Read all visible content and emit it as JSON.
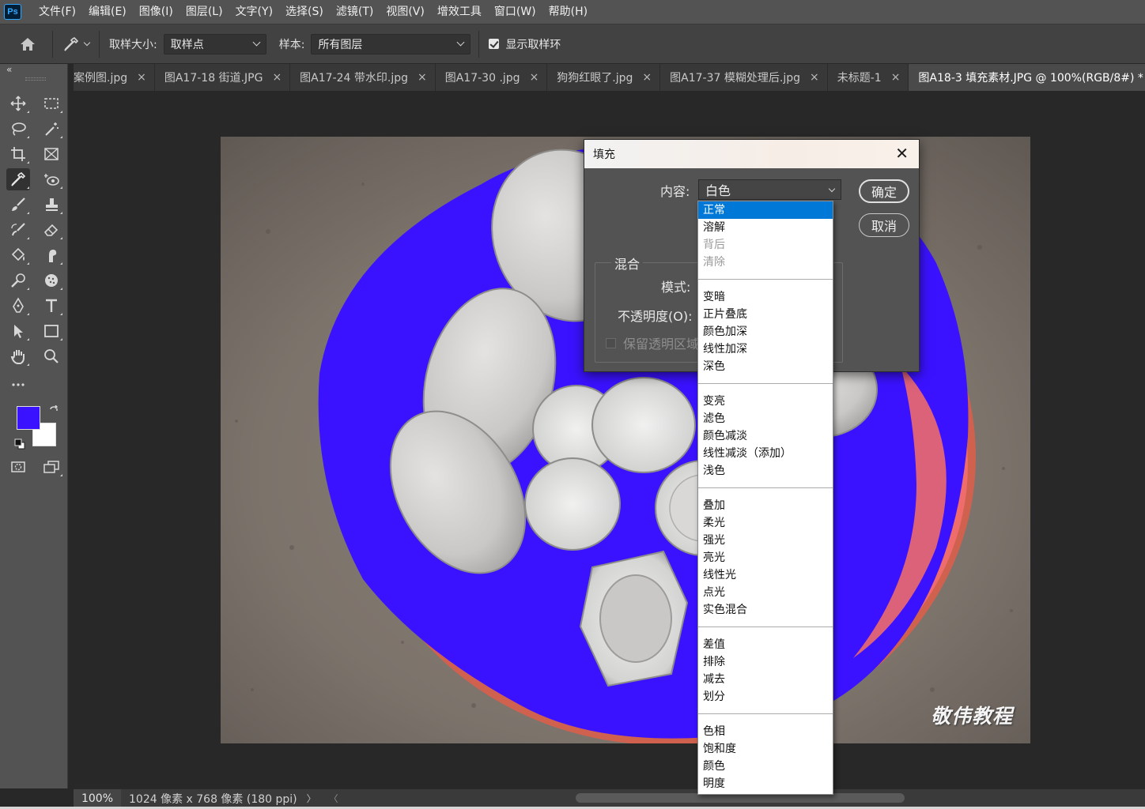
{
  "app": {
    "logo": "Ps"
  },
  "menu": [
    "文件(F)",
    "编辑(E)",
    "图像(I)",
    "图层(L)",
    "文字(Y)",
    "选择(S)",
    "滤镜(T)",
    "视图(V)",
    "增效工具",
    "窗口(W)",
    "帮助(H)"
  ],
  "options": {
    "sample_size_label": "取样大小:",
    "sample_size_value": "取样点",
    "sample_label": "样本:",
    "sample_value": "所有图层",
    "show_ring_label": "显示取样环",
    "show_ring_checked": true
  },
  "tabs": [
    {
      "label": "案例图.jpg",
      "active": false
    },
    {
      "label": "图A17-18 街道.JPG",
      "active": false
    },
    {
      "label": "图A17-24 带水印.jpg",
      "active": false
    },
    {
      "label": "图A17-30 .jpg",
      "active": false
    },
    {
      "label": "狗狗红眼了.jpg",
      "active": false
    },
    {
      "label": "图A17-37 模糊处理后.jpg",
      "active": false
    },
    {
      "label": "未标题-1",
      "active": false
    },
    {
      "label": "图A18-3 填充素材.JPG @ 100%(RGB/8#) *",
      "active": true
    }
  ],
  "toolbar": {
    "collapse": "«",
    "foreground_color": "#3a12ff",
    "background_color": "#ffffff"
  },
  "canvas": {
    "watermark": "敬伟教程"
  },
  "status": {
    "zoom": "100%",
    "doc_info": "1024 像素 x 768 像素 (180 ppi)",
    "arrow": "〉",
    "scroll_left": "〈"
  },
  "fill_dialog": {
    "title": "填充",
    "close": "✕",
    "content_label": "内容:",
    "content_value": "白色",
    "ok_label": "确定",
    "cancel_label": "取消",
    "blend_legend": "混合",
    "mode_label": "模式:",
    "opacity_label": "不透明度(O):",
    "preserve_label": "保留透明区域"
  },
  "blend_modes": [
    [
      {
        "label": "正常",
        "selected": true
      },
      {
        "label": "溶解"
      },
      {
        "label": "背后",
        "disabled": true
      },
      {
        "label": "清除",
        "disabled": true
      }
    ],
    [
      {
        "label": "变暗"
      },
      {
        "label": "正片叠底"
      },
      {
        "label": "颜色加深"
      },
      {
        "label": "线性加深"
      },
      {
        "label": "深色"
      }
    ],
    [
      {
        "label": "变亮"
      },
      {
        "label": "滤色"
      },
      {
        "label": "颜色减淡"
      },
      {
        "label": "线性减淡（添加）"
      },
      {
        "label": "浅色"
      }
    ],
    [
      {
        "label": "叠加"
      },
      {
        "label": "柔光"
      },
      {
        "label": "强光"
      },
      {
        "label": "亮光"
      },
      {
        "label": "线性光"
      },
      {
        "label": "点光"
      },
      {
        "label": "实色混合"
      }
    ],
    [
      {
        "label": "差值"
      },
      {
        "label": "排除"
      },
      {
        "label": "减去"
      },
      {
        "label": "划分"
      }
    ],
    [
      {
        "label": "色相"
      },
      {
        "label": "饱和度"
      },
      {
        "label": "颜色"
      },
      {
        "label": "明度"
      }
    ]
  ],
  "colors": {
    "fill_blue": "#3a12ff",
    "selection_blue": "#0078d7"
  }
}
